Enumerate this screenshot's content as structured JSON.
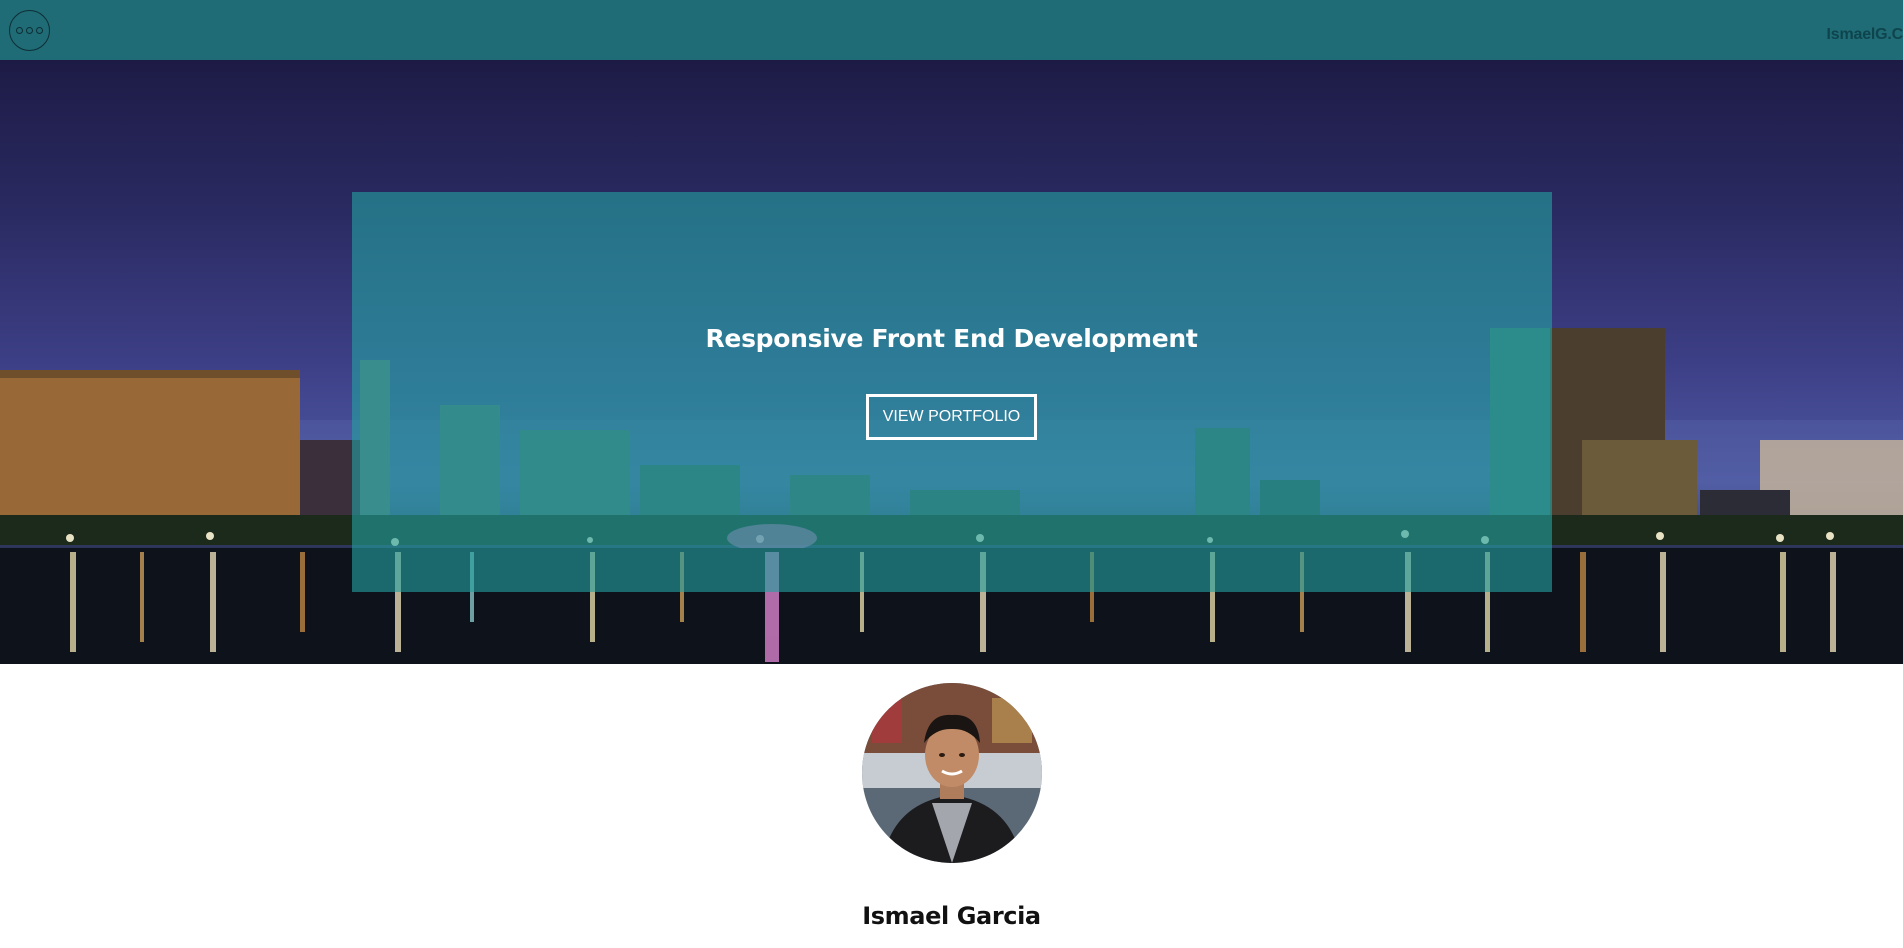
{
  "header": {
    "menu_icon": "ellipsis-circle-icon",
    "brand": "IsmaelG.C"
  },
  "hero": {
    "background_image": "city-skyline-night-lake",
    "title": "Responsive Front End Development",
    "button_label": "VIEW PORTFOLIO"
  },
  "profile": {
    "avatar_image": "profile-photo",
    "name": "Ismael Garcia"
  },
  "colors": {
    "header_bg": "#1f6b76",
    "overlay": "#23a0a0",
    "text_light": "#ffffff",
    "brand_text": "#0e454d"
  }
}
